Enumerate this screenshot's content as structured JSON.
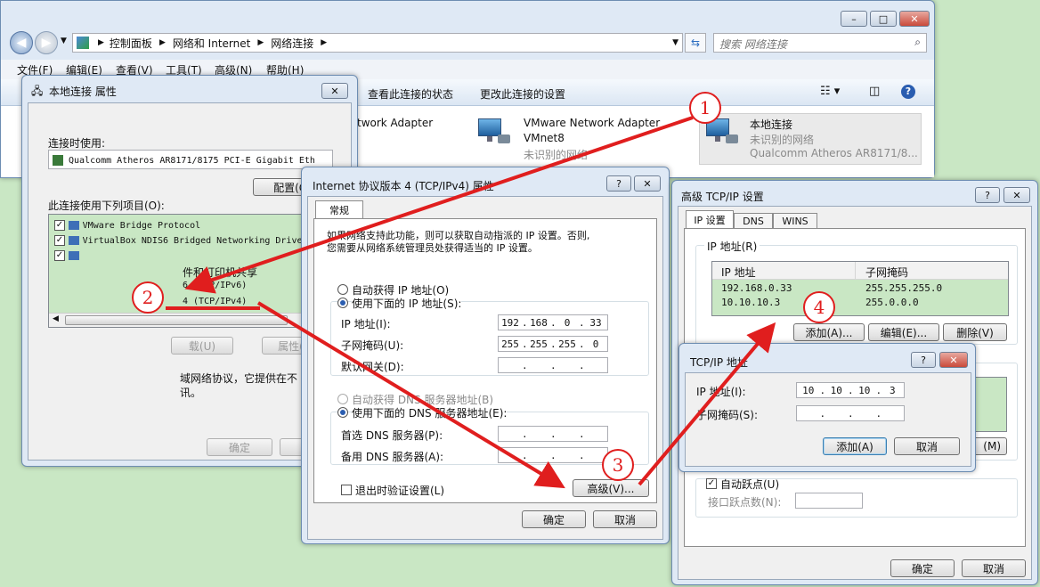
{
  "explorer": {
    "breadcrumb": [
      "控制面板",
      "网络和 Internet",
      "网络连接"
    ],
    "search_placeholder": "搜索 网络连接",
    "menu": [
      "文件(F)",
      "编辑(E)",
      "查看(V)",
      "工具(T)",
      "高级(N)",
      "帮助(H)"
    ],
    "toolbar": [
      "查看此连接的状态",
      "更改此连接的设置"
    ],
    "adapters": [
      {
        "name": "twork Adapter",
        "sub1": "",
        "sub2": ""
      },
      {
        "name": "VMware Network Adapter",
        "sub1": "VMnet8",
        "sub2": "未识别的网络"
      },
      {
        "name": "本地连接",
        "sub1": "未识别的网络",
        "sub2": "Qualcomm Atheros AR8171/8..."
      }
    ]
  },
  "local_props": {
    "title": "本地连接 属性",
    "connect_using_label": "连接时使用:",
    "adapter_name": "Qualcomm Atheros AR8171/8175 PCI-E Gigabit Eth",
    "configure_btn": "配置(C)",
    "items_label": "此连接使用下列项目(O):",
    "items": [
      "VMware Bridge Protocol",
      "VirtualBox NDIS6 Bridged Networking Drive",
      ""
    ],
    "partial_items": [
      "件和打印机共享",
      "6 (TCP/IPv6)",
      "4 (TCP/IPv4)"
    ],
    "install_btn": "载(U)",
    "properties_btn": "属性(R)",
    "desc1": "域网络协议，它提供在不",
    "desc2": "讯。",
    "ok_btn": "确定"
  },
  "ipv4": {
    "title": "Internet 协议版本 4 (TCP/IPv4) 属性",
    "tab": "常规",
    "info1": "如果网络支持此功能，则可以获取自动指派的 IP 设置。否则,",
    "info2": "您需要从网络系统管理员处获得适当的 IP 设置。",
    "auto_ip": "自动获得 IP 地址(O)",
    "manual_ip": "使用下面的 IP 地址(S):",
    "ip_label": "IP 地址(I):",
    "mask_label": "子网掩码(U):",
    "gw_label": "默认网关(D):",
    "ip": [
      "192",
      "168",
      "0",
      "33"
    ],
    "mask": [
      "255",
      "255",
      "255",
      "0"
    ],
    "auto_dns": "自动获得 DNS 服务器地址(B)",
    "manual_dns": "使用下面的 DNS 服务器地址(E):",
    "dns1_label": "首选 DNS 服务器(P):",
    "dns2_label": "备用 DNS 服务器(A):",
    "validate": "退出时验证设置(L)",
    "advanced_btn": "高级(V)...",
    "ok_btn": "确定",
    "cancel_btn": "取消"
  },
  "advanced": {
    "title": "高级 TCP/IP 设置",
    "tabs": [
      "IP 设置",
      "DNS",
      "WINS"
    ],
    "group_label": "IP 地址(R)",
    "col_ip": "IP 地址",
    "col_mask": "子网掩码",
    "rows": [
      {
        "ip": "192.168.0.33",
        "mask": "255.255.255.0"
      },
      {
        "ip": "10.10.10.3",
        "mask": "255.0.0.0"
      }
    ],
    "add_btn": "添加(A)...",
    "edit_btn": "编辑(E)...",
    "delete_btn": "删除(V)",
    "hidden_btn": "(M)",
    "auto_metric": "自动跃点(U)",
    "metric_label": "接口跃点数(N):",
    "ok_btn": "确定",
    "cancel_btn": "取消"
  },
  "tcpip_addr": {
    "title": "TCP/IP 地址",
    "ip_label": "IP 地址(I):",
    "mask_label": "子网掩码(S):",
    "ip": [
      "10",
      "10",
      "10",
      "3"
    ],
    "add_btn": "添加(A)",
    "cancel_btn": "取消"
  },
  "steps": [
    "1",
    "2",
    "3",
    "4"
  ],
  "colors": {
    "annotation": "#e01e1e",
    "list_bg": "#c9e7c4",
    "accent": "#2a5db0"
  }
}
